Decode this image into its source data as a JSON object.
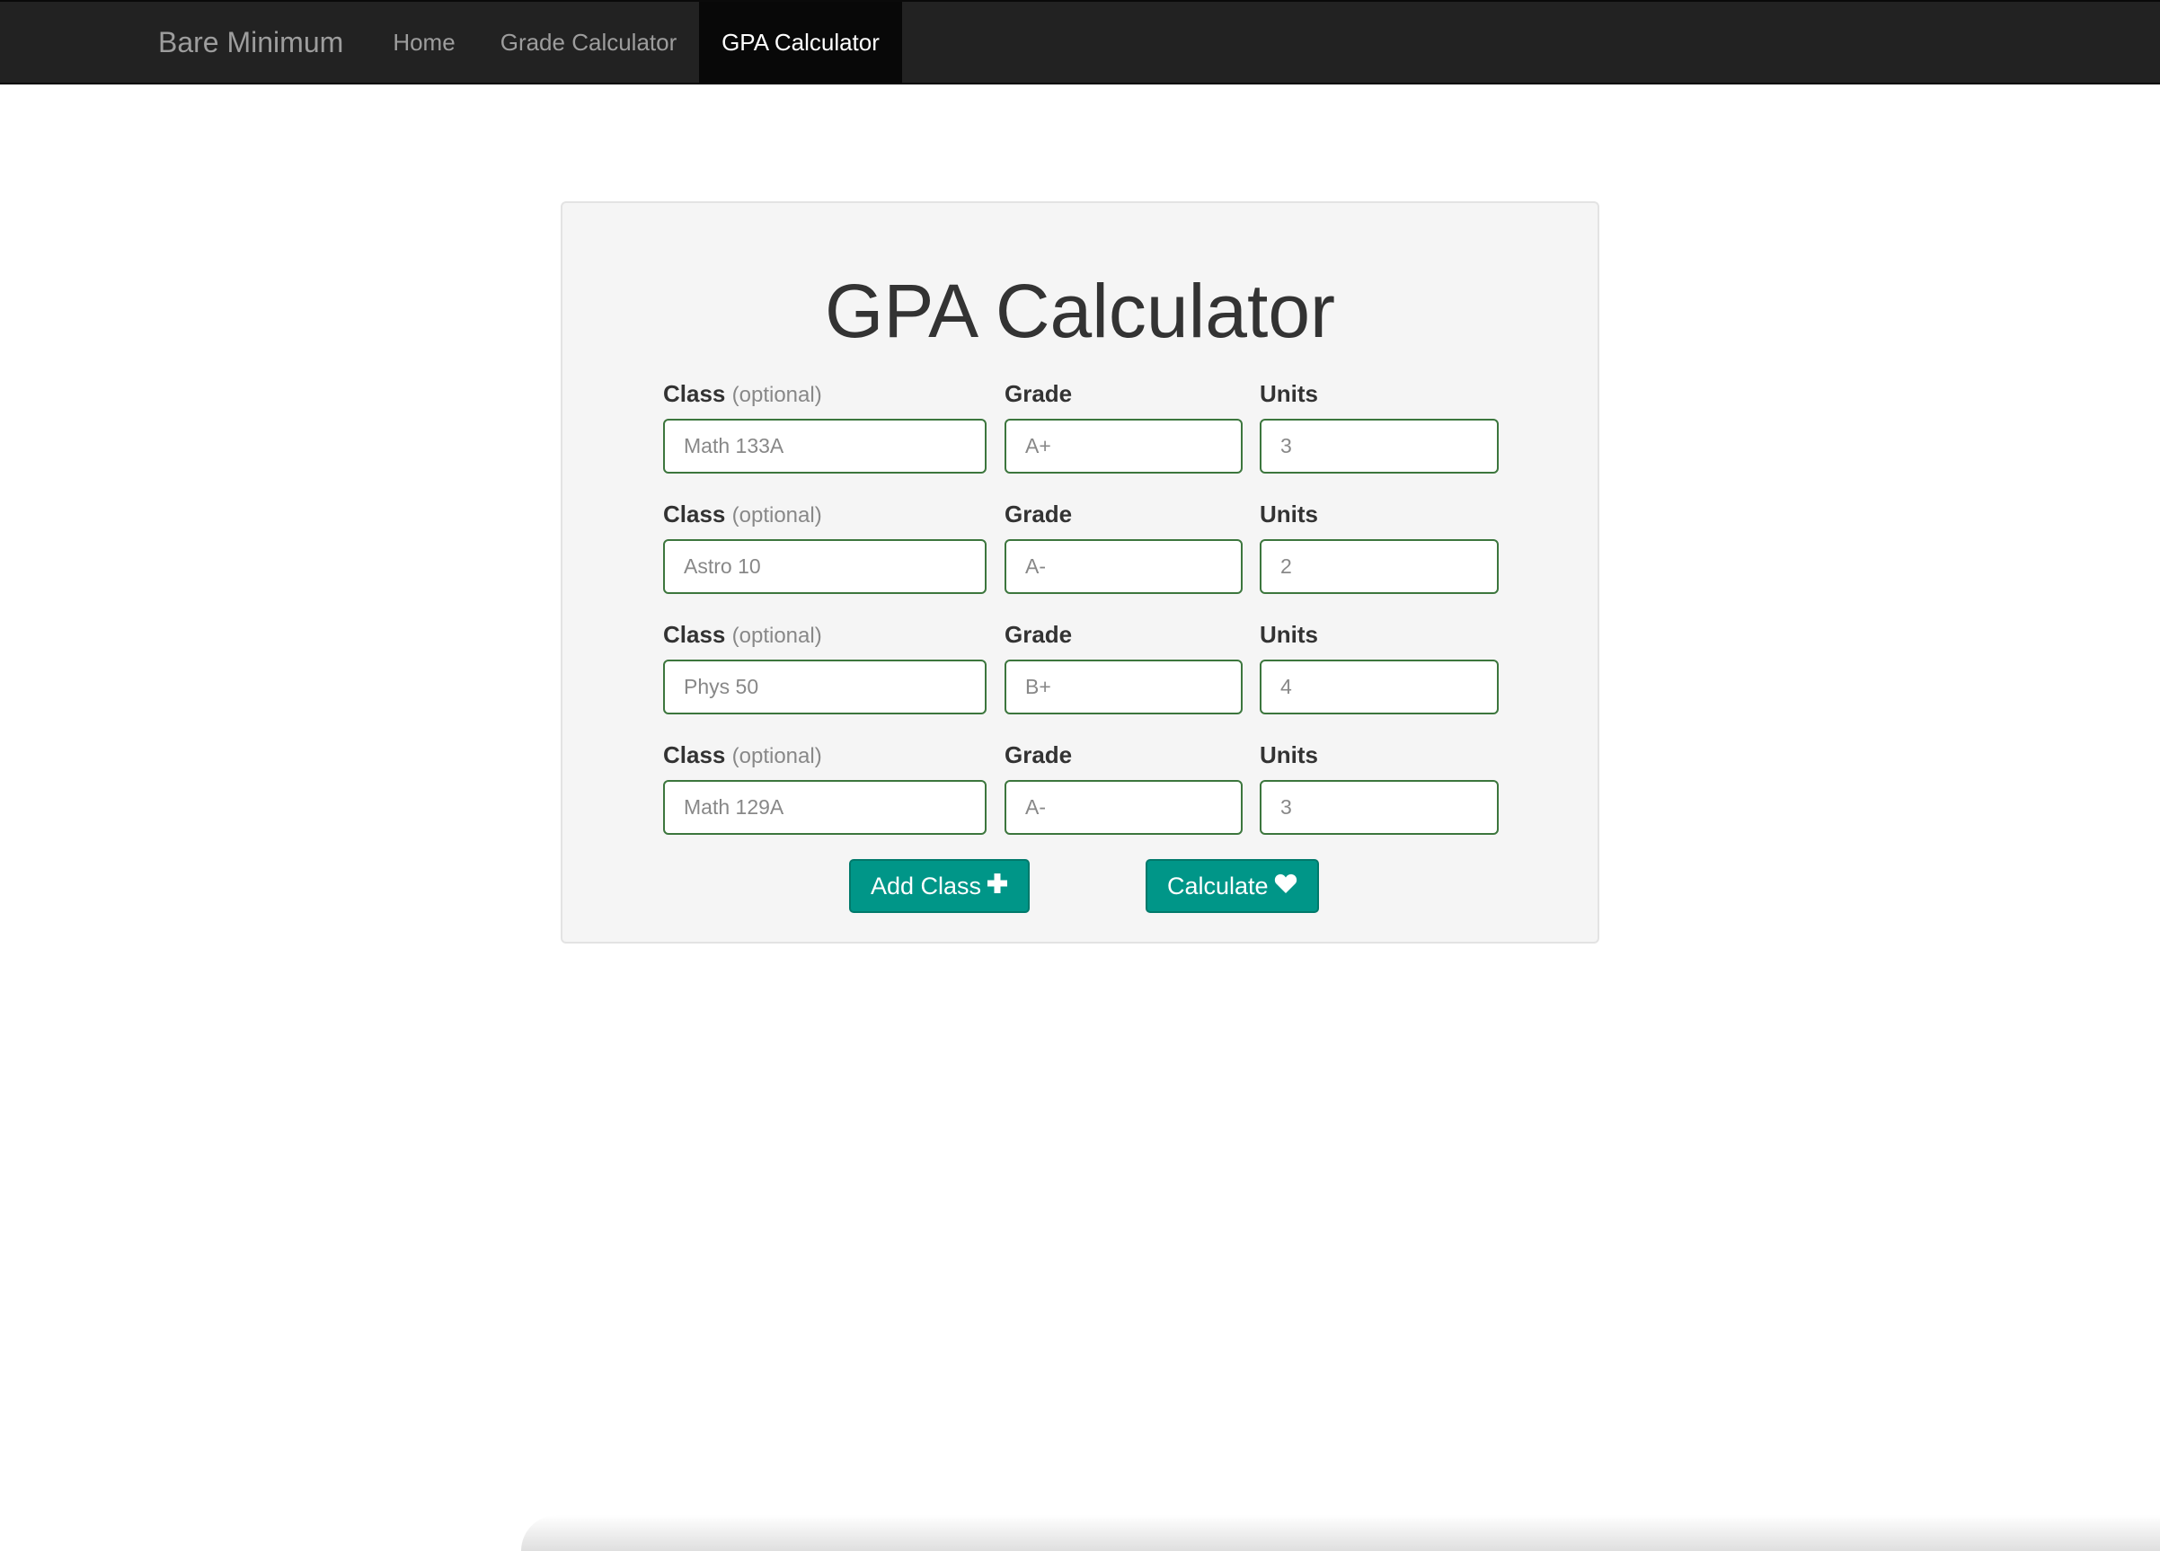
{
  "navbar": {
    "brand": "Bare Minimum",
    "items": [
      {
        "label": "Home",
        "active": false
      },
      {
        "label": "Grade Calculator",
        "active": false
      },
      {
        "label": "GPA Calculator",
        "active": true
      }
    ]
  },
  "calculator": {
    "title": "GPA Calculator",
    "labels": {
      "class": "Class",
      "class_optional": "(optional)",
      "grade": "Grade",
      "units": "Units"
    },
    "rows": [
      {
        "class_placeholder": "Math 133A",
        "grade_placeholder": "A+",
        "units_placeholder": "3"
      },
      {
        "class_placeholder": "Astro 10",
        "grade_placeholder": "A-",
        "units_placeholder": "2"
      },
      {
        "class_placeholder": "Phys 50",
        "grade_placeholder": "B+",
        "units_placeholder": "4"
      },
      {
        "class_placeholder": "Math 129A",
        "grade_placeholder": "A-",
        "units_placeholder": "3"
      }
    ],
    "add_button": {
      "label": "Add Class",
      "icon": "plus-icon"
    },
    "calculate_button": {
      "label": "Calculate",
      "icon": "heart-icon"
    }
  },
  "colors": {
    "navbar_bg": "#222222",
    "active_nav_bg": "#080808",
    "field_border": "#3c763d",
    "button_bg": "#009688"
  }
}
